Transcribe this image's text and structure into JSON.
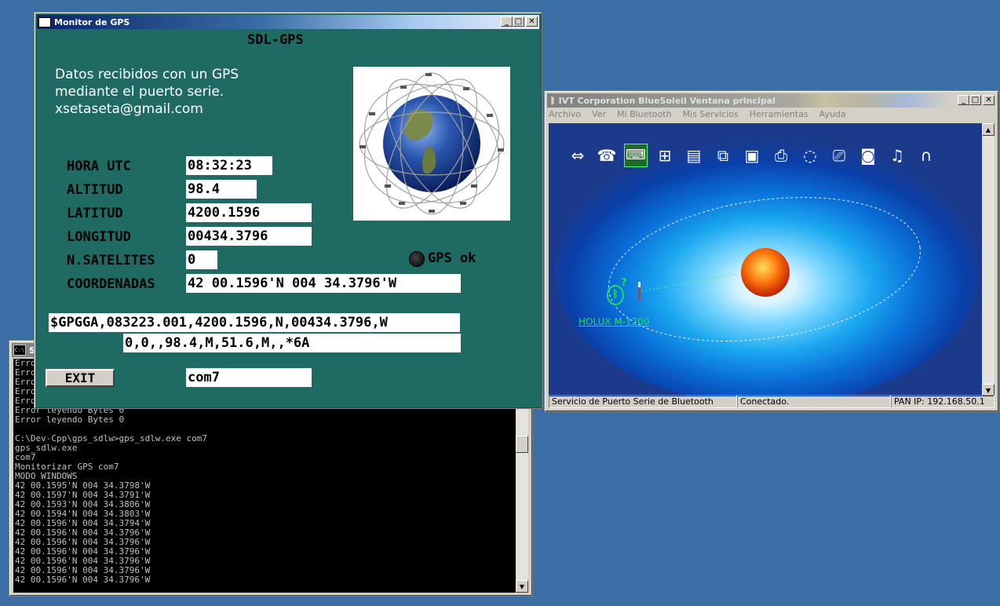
{
  "console": {
    "title": "S",
    "lines": [
      "Error",
      "Error",
      "Error",
      "Error",
      "Error",
      "Error leyendo Bytes 0",
      "Error leyendo Bytes 0",
      "",
      "C:\\Dev-Cpp\\gps_sdlw>gps_sdlw.exe com7",
      "gps_sdlw.exe",
      "com7",
      "Monitorizar GPS com7",
      "MODO WINDOWS",
      "42 00.1595'N 004 34.3798'W",
      "42 00.1597'N 004 34.3791'W",
      "42 00.1593'N 004 34.3806'W",
      "42 00.1594'N 004 34.3803'W",
      "42 00.1596'N 004 34.3794'W",
      "42 00.1596'N 004 34.3796'W",
      "42 00.1596'N 004 34.3796'W",
      "42 00.1596'N 004 34.3796'W",
      "42 00.1596'N 004 34.3796'W",
      "42 00.1596'N 004 34.3796'W",
      "42 00.1596'N 004 34.3796'W"
    ]
  },
  "gps_window": {
    "title": "Monitor de GPS",
    "heading": "SDL-GPS",
    "intro_line1": "Datos recibidos con un GPS",
    "intro_line2": "mediante el puerto serie.",
    "intro_line3": "xsetaseta@gmail.com",
    "fields": {
      "hora_label": "HORA UTC",
      "hora_value": "08:32:23",
      "altitud_label": "ALTITUD",
      "altitud_value": "98.4",
      "latitud_label": "LATITUD",
      "latitud_value": "4200.1596",
      "longitud_label": "LONGITUD",
      "longitud_value": "00434.3796",
      "satelites_label": "N.SATELITES",
      "satelites_value": "0",
      "coordenadas_label": "COORDENADAS",
      "coordenadas_value": "42 00.1596'N 004 34.3796'W"
    },
    "status_text": "GPS ok",
    "nmea_line1": "$GPGGA,083223.001,4200.1596,N,00434.3796,W",
    "nmea_line2": "0,0,,98.4,M,51.6,M,,*6A",
    "exit_label": "EXIT",
    "port_value": "com7"
  },
  "bluesoleil": {
    "title": "IVT Corporation BlueSoleil Ventana principal",
    "menu": [
      "Archivo",
      "Ver",
      "Mi Bluetooth",
      "Mis Servicios",
      "Herramientas",
      "Ayuda"
    ],
    "device_name": "HOLUX M-1200",
    "status_service": "Servicio de Puerto Serie de Bluetooth",
    "status_connection": "Conectado.",
    "status_ip": "PAN IP: 192.168.50.1",
    "service_icons": [
      "network-access-icon",
      "dialup-icon",
      "serial-port-icon",
      "lan-icon",
      "file-transfer-icon",
      "sync-icon",
      "business-card-icon",
      "fax-icon",
      "hid-mouse-icon",
      "printer-icon",
      "camera-icon",
      "audio-icon",
      "headset-icon"
    ]
  },
  "colors": {
    "desktop": "#3a6ea5",
    "gps_background": "#1f6b64",
    "console_background": "#000000",
    "console_text": "#c0c0c0",
    "bluesoleil_canvas": "#1c3a8c"
  }
}
